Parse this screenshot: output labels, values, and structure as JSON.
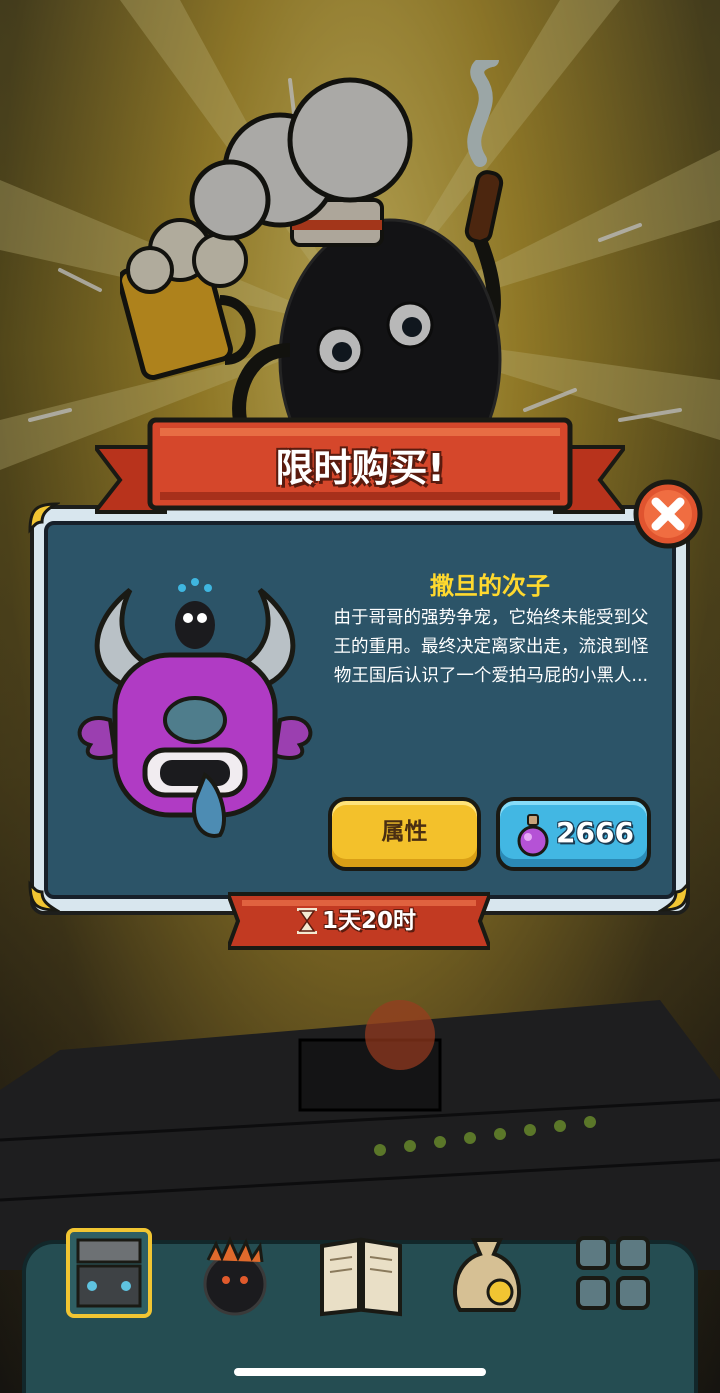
{
  "dialog": {
    "title": "限时购买!",
    "item_name": "撒旦的次子",
    "item_description": "由于哥哥的强势争宠，它始终未能受到父王的重用。最终决定离家出走，流浪到怪物王国后认识了一个爱拍马屁的小黑人...",
    "attributes_button": "属性",
    "price": "2666",
    "price_currency_icon": "potion-icon",
    "timer": "1天20时",
    "close_icon": "close-icon"
  },
  "nav": {
    "items": [
      {
        "icon": "kitchen-station-icon"
      },
      {
        "icon": "monster-icon"
      },
      {
        "icon": "book-icon"
      },
      {
        "icon": "money-bag-icon"
      },
      {
        "icon": "grid-menu-icon"
      }
    ]
  },
  "colors": {
    "title_ribbon": "#d5472b",
    "panel": "#2c5468",
    "item_name": "#ffd92e",
    "attr_button": "#f3c12b",
    "buy_button": "#42b7e3"
  }
}
